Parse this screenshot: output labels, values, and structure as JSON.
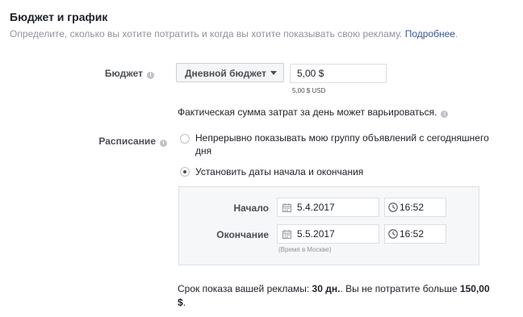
{
  "header": {
    "title": "Бюджет и график",
    "subtitle": "Определите, сколько вы хотите потратить и когда вы хотите показывать свою рекламу.",
    "learn_more": "Подробнее",
    "subtitle_end": "."
  },
  "budget": {
    "label": "Бюджет",
    "type_selected": "Дневной бюджет",
    "amount_value": "5,00 $",
    "amount_usd": "5,00 $ USD",
    "note": "Фактическая сумма затрат за день может варьироваться."
  },
  "schedule": {
    "label": "Расписание",
    "option_continuous_line1": "Непрерывно показывать мою группу объявлений с сегодняшнего",
    "option_continuous_line2": "дня",
    "option_dates": "Установить даты начала и окончания",
    "start_label": "Начало",
    "start_date": "5.4.2017",
    "start_time": "16:52",
    "end_label": "Окончание",
    "end_date": "5.5.2017",
    "end_time": "16:52",
    "timezone_note": "(Время в Москве)"
  },
  "summary": {
    "part1": "Срок показа вашей рекламы: ",
    "duration": "30 дн.",
    "part2": ". Вы не потратите больше ",
    "amount_line1": "150,00",
    "amount_line2": "$",
    "end": "."
  },
  "colors": {
    "link": "#365899",
    "muted_text": "#90949c",
    "label_text": "#4b4f56",
    "panel_bg": "#f6f7f9",
    "border": "#dddfe2"
  },
  "icons": [
    "info-icon",
    "chevron-down-icon",
    "calendar-icon",
    "clock-icon"
  ]
}
